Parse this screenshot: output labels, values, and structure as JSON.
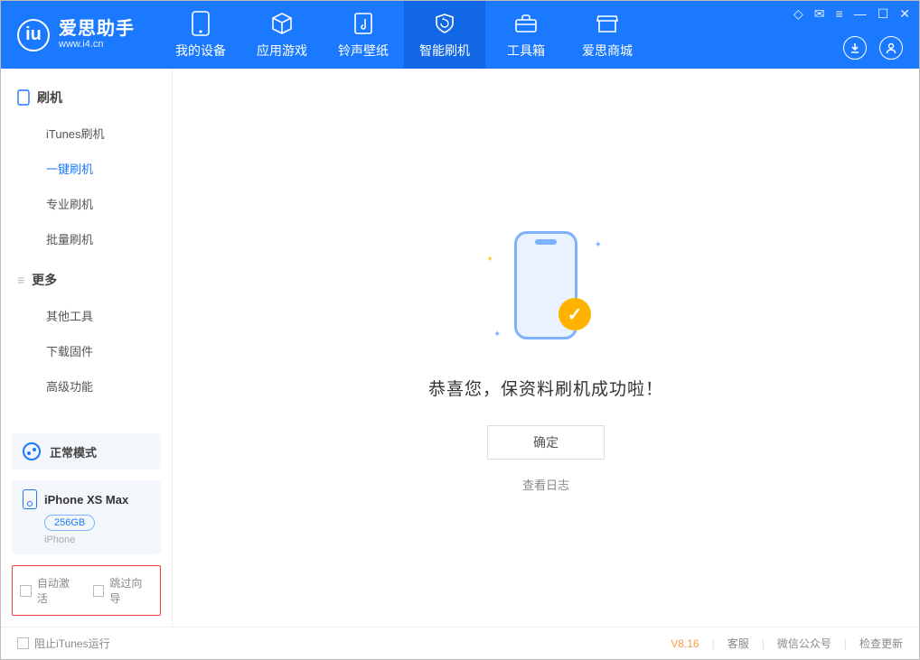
{
  "logo": {
    "title": "爱思助手",
    "subtitle": "www.i4.cn",
    "mark": "iu"
  },
  "topnav": [
    {
      "label": "我的设备"
    },
    {
      "label": "应用游戏"
    },
    {
      "label": "铃声壁纸"
    },
    {
      "label": "智能刷机"
    },
    {
      "label": "工具箱"
    },
    {
      "label": "爱思商城"
    }
  ],
  "sidebar": {
    "group1": {
      "title": "刷机",
      "items": [
        "iTunes刷机",
        "一键刷机",
        "专业刷机",
        "批量刷机"
      ]
    },
    "group2": {
      "title": "更多",
      "items": [
        "其他工具",
        "下载固件",
        "高级功能"
      ]
    }
  },
  "mode": {
    "label": "正常模式"
  },
  "device": {
    "name": "iPhone XS Max",
    "storage": "256GB",
    "type": "iPhone"
  },
  "options": {
    "auto_activate": "自动激活",
    "skip_guide": "跳过向导"
  },
  "main": {
    "success_msg": "恭喜您，保资料刷机成功啦！",
    "ok_label": "确定",
    "view_log": "查看日志"
  },
  "footer": {
    "block_itunes": "阻止iTunes运行",
    "version": "V8.16",
    "links": [
      "客服",
      "微信公众号",
      "检查更新"
    ]
  }
}
